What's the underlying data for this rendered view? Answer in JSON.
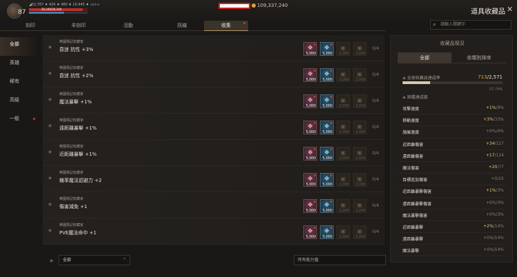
{
  "player": {
    "level": "87",
    "stats_line": "◢52,767  ♦ 426  ♦ 480  ♦ 10,445  ♦ ∞/∞∞",
    "hp_text": "26,240/26,240"
  },
  "gold": "109,337,240",
  "page_title": "道具收藏品",
  "close_label": "✕",
  "tabs": [
    {
      "label": "刻印",
      "dot": false
    },
    {
      "label": "非刻印",
      "dot": false
    },
    {
      "label": "活動",
      "dot": false
    },
    {
      "label": "訊織",
      "dot": false
    },
    {
      "label": "收集",
      "dot": true,
      "active": true
    }
  ],
  "search": {
    "placeholder": "請輸入關鍵字"
  },
  "sidebar": [
    {
      "label": "全部",
      "active": true,
      "dot": false
    },
    {
      "label": "英雄",
      "active": false,
      "dot": false
    },
    {
      "label": "稀有",
      "active": false,
      "dot": false
    },
    {
      "label": "高級",
      "active": false,
      "dot": false
    },
    {
      "label": "一般",
      "active": false,
      "dot": true
    }
  ],
  "rows": [
    {
      "sub": "樂園標記收藏家",
      "name": "昏迷 抗性 +3%",
      "slots": [
        "5,000",
        "5,000",
        "2,000",
        "2,000"
      ],
      "count": "0/4"
    },
    {
      "sub": "樂園標記收藏家",
      "name": "昏迷 抗性 +2%",
      "slots": [
        "5,000",
        "5,000",
        "2,000",
        "2,000"
      ],
      "count": "0/4"
    },
    {
      "sub": "樂園標記收藏家",
      "name": "魔法暴擊 +1%",
      "slots": [
        "5,000",
        "5,000",
        "2,000",
        "2,000"
      ],
      "count": "0/4"
    },
    {
      "sub": "樂園標記收藏家",
      "name": "遠距離暴擊 +1%",
      "slots": [
        "5,000",
        "5,000",
        "2,000",
        "2,000"
      ],
      "count": "0/4"
    },
    {
      "sub": "樂園標記收藏家",
      "name": "近距離暴擊 +1%",
      "slots": [
        "5,000",
        "5,000",
        "2,000",
        "2,000"
      ],
      "count": "0/4"
    },
    {
      "sub": "樂園標記收藏家",
      "name": "機率魔法迴避力 +2",
      "slots": [
        "5,000",
        "5,000",
        "2,000",
        "2,000"
      ],
      "count": "0/4"
    },
    {
      "sub": "樂園標記收藏家",
      "name": "傷害減免 +1",
      "slots": [
        "5,000",
        "5,000",
        "2,000",
        "2,000"
      ],
      "count": "0/4"
    },
    {
      "sub": "樂園標記收藏家",
      "name": "PVE魔法命中 +1",
      "slots": [
        "5,000",
        "5,000",
        "2,000",
        "2,000"
      ],
      "count": "0/4"
    }
  ],
  "bottom": {
    "dropdown_value": "全部",
    "filter_value": "所有能力值"
  },
  "right_panel": {
    "title": "收藏品現況",
    "tab_all": "全部",
    "tab_sort": "依類別排序",
    "total_label": "全部收藏品達成率",
    "total_done": "713",
    "total_max": "/2,571",
    "total_pct": "27.73%",
    "section_label": "固鑑達成度",
    "stats": [
      {
        "label": "攻擊速度",
        "gain": "+1%",
        "max": "/9%"
      },
      {
        "label": "移動速度",
        "gain": "+3%",
        "max": "/33%"
      },
      {
        "label": "施展速度",
        "gain": "+0%",
        "max": "/4%"
      },
      {
        "label": "近距離傷害",
        "gain": "+34",
        "max": "/127"
      },
      {
        "label": "遠距離傷害",
        "gain": "+17",
        "max": "/124"
      },
      {
        "label": "魔法傷害",
        "gain": "+20",
        "max": "/77"
      },
      {
        "label": "目標追加傷害",
        "gain": "+0",
        "max": "/15"
      },
      {
        "label": "近距離暴擊傷害",
        "gain": "+1%",
        "max": "/3%"
      },
      {
        "label": "遠距離暴擊傷害",
        "gain": "+0%",
        "max": "/3%"
      },
      {
        "label": "魔法暴擊傷害",
        "gain": "+0%",
        "max": "/3%"
      },
      {
        "label": "近距離暴擊",
        "gain": "+2%",
        "max": "/14%"
      },
      {
        "label": "遠距離暴擊",
        "gain": "+0%",
        "max": "/14%"
      },
      {
        "label": "魔法暴擊",
        "gain": "+0%",
        "max": "/14%"
      }
    ]
  }
}
